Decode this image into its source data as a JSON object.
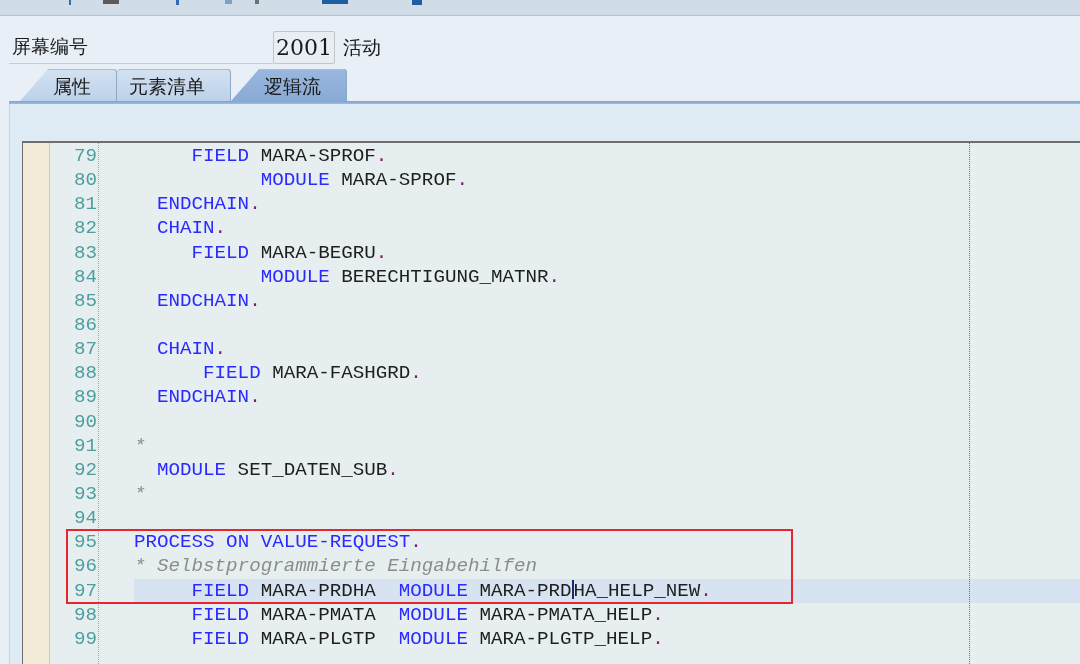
{
  "screen_number": {
    "label": "屏幕编号",
    "value": "2001",
    "status": "活动"
  },
  "tabs": [
    {
      "label": "属性",
      "selected": false
    },
    {
      "label": "元素清单",
      "selected": false
    },
    {
      "label": "逻辑流",
      "selected": true
    }
  ],
  "editor": {
    "lines": [
      {
        "number": "79",
        "current": false,
        "framed": false,
        "tokens": [
          {
            "text": "     FIELD",
            "kind": "keyword"
          },
          {
            "text": " MARA-SPROF",
            "kind": "name"
          },
          {
            "text": ".",
            "kind": "period"
          }
        ]
      },
      {
        "number": "80",
        "current": false,
        "framed": false,
        "tokens": [
          {
            "text": "           MODULE",
            "kind": "keyword"
          },
          {
            "text": " MARA-SPROF",
            "kind": "name"
          },
          {
            "text": ".",
            "kind": "period"
          }
        ]
      },
      {
        "number": "81",
        "current": false,
        "framed": false,
        "tokens": [
          {
            "text": "  ENDCHAIN",
            "kind": "keyword"
          },
          {
            "text": ".",
            "kind": "period"
          }
        ]
      },
      {
        "number": "82",
        "current": false,
        "framed": false,
        "tokens": [
          {
            "text": "  CHAIN",
            "kind": "keyword"
          },
          {
            "text": ".",
            "kind": "period"
          }
        ]
      },
      {
        "number": "83",
        "current": false,
        "framed": false,
        "tokens": [
          {
            "text": "     FIELD",
            "kind": "keyword"
          },
          {
            "text": " MARA-BEGRU",
            "kind": "name"
          },
          {
            "text": ".",
            "kind": "period"
          }
        ]
      },
      {
        "number": "84",
        "current": false,
        "framed": false,
        "tokens": [
          {
            "text": "           MODULE",
            "kind": "keyword"
          },
          {
            "text": " BERECHTIGUNG_MATNR",
            "kind": "name"
          },
          {
            "text": ".",
            "kind": "period"
          }
        ]
      },
      {
        "number": "85",
        "current": false,
        "framed": false,
        "tokens": [
          {
            "text": "  ENDCHAIN",
            "kind": "keyword"
          },
          {
            "text": ".",
            "kind": "period"
          }
        ]
      },
      {
        "number": "86",
        "current": false,
        "framed": false
      },
      {
        "number": "87",
        "current": false,
        "framed": false,
        "tokens": [
          {
            "text": "  CHAIN",
            "kind": "keyword"
          },
          {
            "text": ".",
            "kind": "period"
          }
        ]
      },
      {
        "number": "88",
        "current": false,
        "framed": false,
        "tokens": [
          {
            "text": "      FIELD",
            "kind": "keyword"
          },
          {
            "text": " MARA-FASHGRD",
            "kind": "name"
          },
          {
            "text": ".",
            "kind": "period"
          }
        ]
      },
      {
        "number": "89",
        "current": false,
        "framed": false,
        "tokens": [
          {
            "text": "  ENDCHAIN",
            "kind": "keyword"
          },
          {
            "text": ".",
            "kind": "period"
          }
        ]
      },
      {
        "number": "90",
        "current": false,
        "framed": false
      },
      {
        "number": "91",
        "current": false,
        "framed": false,
        "tokens": [
          {
            "text": "*",
            "kind": "comment"
          }
        ]
      },
      {
        "number": "92",
        "current": false,
        "framed": false,
        "tokens": [
          {
            "text": "  MODULE",
            "kind": "keyword"
          },
          {
            "text": " SET_DATEN_SUB",
            "kind": "name"
          },
          {
            "text": ".",
            "kind": "period"
          }
        ]
      },
      {
        "number": "93",
        "current": false,
        "framed": false,
        "tokens": [
          {
            "text": "*",
            "kind": "comment"
          }
        ]
      },
      {
        "number": "94",
        "current": false,
        "framed": false
      },
      {
        "number": "95",
        "current": false,
        "framed": true,
        "tokens": [
          {
            "text": "PROCESS ON VALUE-REQUEST",
            "kind": "keyword"
          },
          {
            "text": ".",
            "kind": "period"
          }
        ]
      },
      {
        "number": "96",
        "current": false,
        "framed": true,
        "tokens": [
          {
            "text": "* Selbstprogrammierte Eingabehilfen",
            "kind": "comment"
          }
        ]
      },
      {
        "number": "97",
        "current": true,
        "framed": true,
        "tokens": [
          {
            "text": "     FIELD",
            "kind": "keyword"
          },
          {
            "text": " MARA-PRDHA  ",
            "kind": "name"
          },
          {
            "text": "MODULE",
            "kind": "keyword"
          },
          {
            "text": " MARA-PRD",
            "kind": "name"
          },
          {
            "kind": "caret"
          },
          {
            "text": "HA_HELP_NEW",
            "kind": "name"
          },
          {
            "text": ".",
            "kind": "period"
          }
        ]
      },
      {
        "number": "98",
        "current": false,
        "framed": false,
        "tokens": [
          {
            "text": "     FIELD",
            "kind": "keyword"
          },
          {
            "text": " MARA-PMATA  ",
            "kind": "name"
          },
          {
            "text": "MODULE",
            "kind": "keyword"
          },
          {
            "text": " MARA-PMATA_HELP",
            "kind": "name"
          },
          {
            "text": ".",
            "kind": "period"
          }
        ]
      },
      {
        "number": "99",
        "current": false,
        "framed": false,
        "tokens": [
          {
            "text": "     FIELD",
            "kind": "keyword"
          },
          {
            "text": " MARA-PLGTP  ",
            "kind": "name"
          },
          {
            "text": "MODULE",
            "kind": "keyword"
          },
          {
            "text": " MARA-PLGTP_HELP",
            "kind": "name"
          },
          {
            "text": ".",
            "kind": "period"
          }
        ]
      }
    ]
  }
}
